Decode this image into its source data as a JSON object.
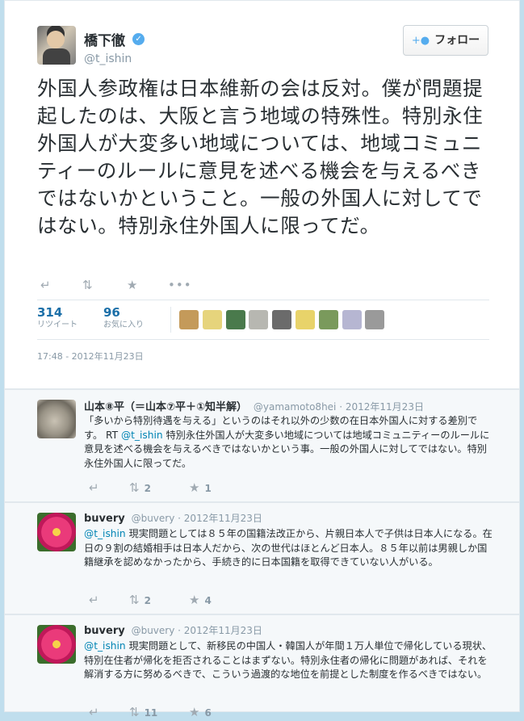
{
  "main_tweet": {
    "display_name": "橋下徹",
    "screen_name": "@t_ishin",
    "follow_button_label": "フォロー",
    "text": "外国人参政権は日本維新の会は反対。僕が問題提起したのは、大阪と言う地域の特殊性。特別永住外国人が大変多い地域については、地域コミュニティーのルールに意見を述べる機会を与えるべきではないかということ。一般の外国人に対してではない。特別永住外国人に限ってだ。",
    "actions": {
      "reply_icon": "reply-icon",
      "retweet_icon": "retweet-icon",
      "favorite_icon": "star-icon",
      "more_icon": "more-icon"
    },
    "stats": {
      "retweets": {
        "count": "314",
        "label": "リツイート"
      },
      "favorites": {
        "count": "96",
        "label": "お気に入り"
      }
    },
    "favoriter_avatar_colors": [
      "#c49a5a",
      "#e6d47c",
      "#4a7a4c",
      "#b7b7b1",
      "#6b6b6b",
      "#e8d36a",
      "#7a9a5c",
      "#b6b6d2",
      "#9a9a9a"
    ],
    "timestamp": "17:48 - 2012年11月23日"
  },
  "replies": [
    {
      "display_name": "山本⑧平（＝山本⑦平＋①知半解）",
      "screen_name": "@yamamoto8hei",
      "date": "2012年11月23日",
      "text_before": "「多いから特別待遇を与える」というのはそれ以外の少数の在日本外国人に対する差別です。 RT ",
      "mention": "@t_ishin",
      "text_after": " 特別永住外国人が大変多い地域については地域コミュニティーのルールに意見を述べる機会を与えるべきではないかという事。一般の外国人に対してではない。特別永住外国人に限ってだ。",
      "retweet_count": "2",
      "favorite_count": "1"
    },
    {
      "display_name": "buvery",
      "screen_name": "@buvery",
      "date": "2012年11月23日",
      "text_before": "",
      "mention": "@t_ishin",
      "text_after": " 現実問題としては８５年の国籍法改正から、片親日本人で子供は日本人になる。在日の９割の結婚相手は日本人だから、次の世代はほとんど日本人。８５年以前は男親しか国籍継承を認めなかったから、手続き的に日本国籍を取得できていない人がいる。",
      "retweet_count": "2",
      "favorite_count": "4"
    },
    {
      "display_name": "buvery",
      "screen_name": "@buvery",
      "date": "2012年11月23日",
      "text_before": "",
      "mention": "@t_ishin",
      "text_after": " 現実問題として、新移民の中国人・韓国人が年間１万人単位で帰化している現状、特別在住者が帰化を拒否されることはまずない。特別永住者の帰化に問題があれば、それを解消する方に努めるべきで、こういう過渡的な地位を前提とした制度を作るべきではない。",
      "retweet_count": "11",
      "favorite_count": "6"
    }
  ]
}
